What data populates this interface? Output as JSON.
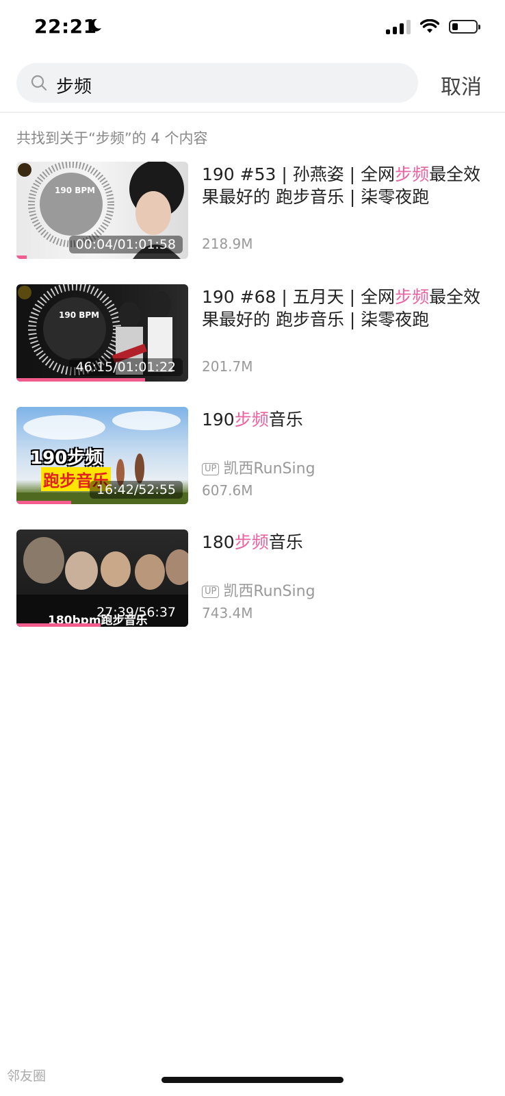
{
  "status_bar": {
    "time": "22:21",
    "moon_icon": "moon-icon",
    "signal_icon": "cellular-signal-icon",
    "wifi_icon": "wifi-icon",
    "battery_icon": "battery-icon"
  },
  "search": {
    "query": "步频",
    "cancel_label": "取消"
  },
  "summary": "共找到关于“步频”的 4 个内容",
  "results": [
    {
      "title_pre": "190 #53 | 孙燕姿 | 全网",
      "title_hl": "步频",
      "title_post": "最全效果最好的 跑步音乐 | 柒零夜跑",
      "duration": "00:04/01:01:58",
      "progress": 0.06,
      "views": "218.9M",
      "thumb_text": "190 BPM"
    },
    {
      "title_pre": "190 #68 | 五月天 | 全网",
      "title_hl": "步频",
      "title_post": "最全效果最好的 跑步音乐 | 柒零夜跑",
      "duration": "46:15/01:01:22",
      "progress": 0.75,
      "views": "201.7M",
      "thumb_text": "190 BPM"
    },
    {
      "title_pre": "190",
      "title_hl": "步频",
      "title_post": "音乐",
      "duration": "16:42/52:55",
      "progress": 0.32,
      "uploader_badge": "UP",
      "uploader": "凯西RunSing",
      "views": "607.6M",
      "thumb_text_1": "190步频",
      "thumb_text_2": "跑步音乐"
    },
    {
      "title_pre": "180",
      "title_hl": "步频",
      "title_post": "音乐",
      "duration": "27:39/56:37",
      "progress": 0.49,
      "uploader_badge": "UP",
      "uploader": "凯西RunSing",
      "views": "743.4M",
      "thumb_text": "180bpm跑步音乐"
    }
  ],
  "watermark": "邻友圈"
}
